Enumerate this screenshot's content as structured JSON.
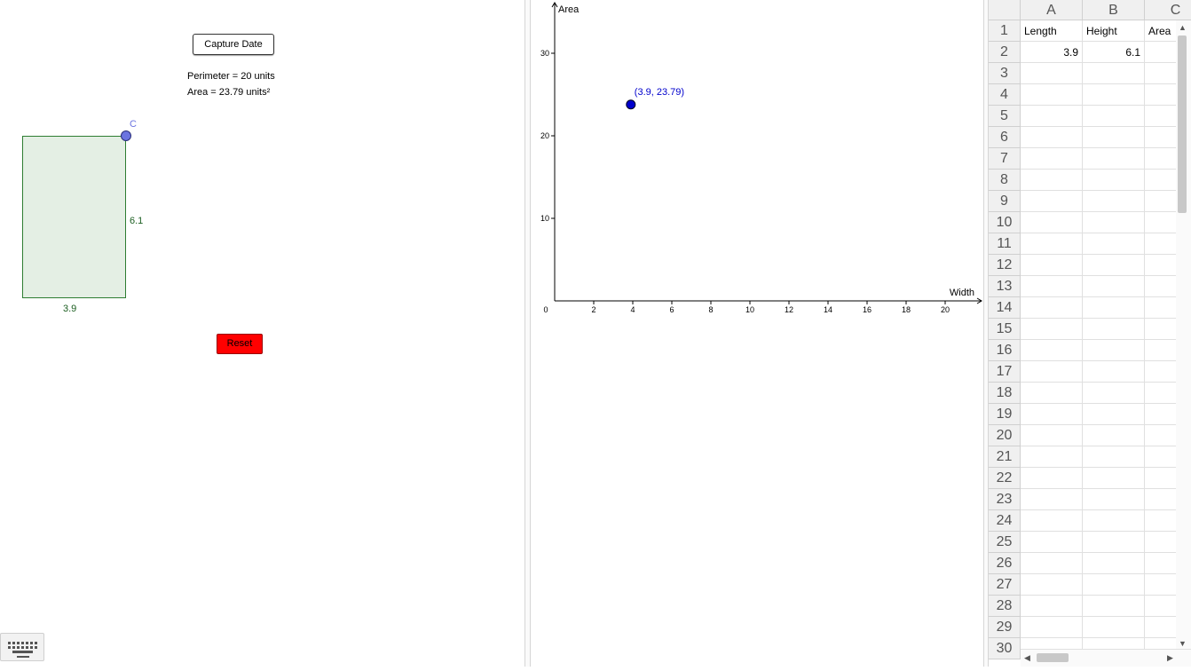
{
  "geometry_view": {
    "capture_button": "Capture Date",
    "perimeter_text": "Perimeter = 20 units",
    "area_text": "Area = 23.79 units²",
    "point_label": "C",
    "width_label": "3.9",
    "height_label": "6.1",
    "reset_button": "Reset",
    "keyboard_icon": "keyboard-icon"
  },
  "graph_view": {
    "point_label": "(3.9, 23.79)",
    "colors": {
      "point": "#0000cc",
      "label": "#0000cc"
    }
  },
  "chart_data": {
    "type": "scatter",
    "xlabel": "Width",
    "ylabel": "Area",
    "xlim": [
      0,
      22
    ],
    "ylim": [
      0,
      36
    ],
    "x_ticks": [
      0,
      2,
      4,
      6,
      8,
      10,
      12,
      14,
      16,
      18,
      20
    ],
    "y_ticks": [
      10,
      20,
      30
    ],
    "points": [
      {
        "x": 3.9,
        "y": 23.79,
        "label": "(3.9, 23.79)"
      }
    ]
  },
  "spreadsheet": {
    "columns": [
      "A",
      "B",
      "C"
    ],
    "rows": [
      "1",
      "2",
      "3",
      "4",
      "5",
      "6",
      "7",
      "8",
      "9",
      "10",
      "11",
      "12",
      "13",
      "14",
      "15",
      "16",
      "17",
      "18",
      "19",
      "20",
      "21",
      "22",
      "23",
      "24",
      "25",
      "26",
      "27",
      "28",
      "29",
      "30"
    ],
    "cells": {
      "A1": "Length",
      "B1": "Height",
      "C1": "Area",
      "A2": "3.9",
      "B2": "6.1"
    }
  }
}
